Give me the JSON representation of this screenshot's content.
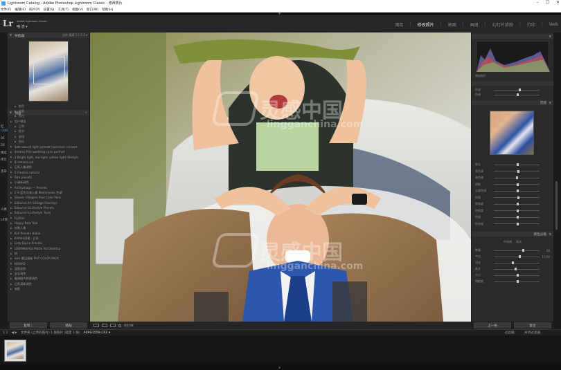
{
  "window": {
    "title": "Lightroom Catalog - Adobe Photoshop Lightroom Classic - 修改照片",
    "controls": [
      "–",
      "☐",
      "✕"
    ]
  },
  "menu": [
    "文件(F)",
    "编辑(E)",
    "照片(P)",
    "设置(S)",
    "工具(T)",
    "视图(V)",
    "窗口(W)",
    "帮助(H)"
  ],
  "identity": {
    "logo": "Lr",
    "subtitle": "Adobe Lightroom Classic",
    "user": "喵 渣 ▾"
  },
  "modules": {
    "items": [
      "图库",
      "修改照片",
      "地图",
      "画册",
      "幻灯片放映",
      "打印",
      "Web"
    ],
    "active_index": 1
  },
  "left_panel": {
    "navigator_header": "导航器",
    "navigator_right": "适合 填满 1:1 1:3 ▾",
    "presets_header": "预设",
    "presets_header_right": "+",
    "presets": [
      {
        "label": "颜色",
        "sub": true
      },
      {
        "label": "创意",
        "sub": true
      },
      {
        "label": "黑白",
        "sub": true
      },
      {
        "label": "用户预设",
        "sub": false
      },
      {
        "label": "日常",
        "sub": true
      },
      {
        "label": "细节",
        "sub": true
      },
      {
        "label": "曲线",
        "sub": true
      },
      {
        "label": "锐化",
        "sub": true
      },
      {
        "label": "Soft natural light portrait haemazin monart",
        "sub": false
      },
      {
        "label": "dreamy film wedding cyan portrait",
        "sub": false
      },
      {
        "label": "3 Bright light, low light, yellow light lifestyle",
        "sub": false
      },
      {
        "label": "B camera set",
        "sub": false
      },
      {
        "label": "日系人像调色",
        "sub": false
      },
      {
        "label": "5 Cinema natural",
        "sub": false
      },
      {
        "label": "Film presets",
        "sub": false
      },
      {
        "label": "小清新调色",
        "sub": false
      },
      {
        "label": "Archipelago — Presets",
        "sub": false
      },
      {
        "label": "C A 蓝色冷调人像 Mommasen 色调",
        "sub": false
      },
      {
        "label": "Glacier Villagine Pool Color Pack",
        "sub": false
      },
      {
        "label": "Editorial Art Vintage Overlays",
        "sub": false
      },
      {
        "label": "Editorial & Lifestyle Presets",
        "sub": false
      },
      {
        "label": "Editorial & Lifestyle Tools",
        "sub": false
      },
      {
        "label": "Fujifilm",
        "sub": false
      },
      {
        "label": "Happy New Year",
        "sub": false
      },
      {
        "label": "肖像人像",
        "sub": false
      },
      {
        "label": "KLP Presets Hobie",
        "sub": false
      },
      {
        "label": "Kinfolk风格 · 日系",
        "sub": false
      },
      {
        "label": "Lady Byrne Presets",
        "sub": false
      },
      {
        "label": "LOWMAN Kid Matte Vol Desktop",
        "sub": false
      },
      {
        "label": "Ni",
        "sub": false
      },
      {
        "label": "own 夏日清新 PHP COLOR PACK",
        "sub": false
      },
      {
        "label": "NOMAD",
        "sub": false
      },
      {
        "label": "温柔皮肤",
        "sub": false
      },
      {
        "label": "宝宝调色",
        "sub": false
      },
      {
        "label": "暖调胶片质感调色",
        "sub": false
      },
      {
        "label": "日系清新调色",
        "sub": false
      },
      {
        "label": "电影",
        "sub": false
      }
    ],
    "side_labels": [
      "红",
      "(1000)/5",
      "05",
      "20",
      "精选",
      "拷贝",
      "黑白",
      "人像",
      "LR预设"
    ],
    "buttons": [
      "复制...",
      "粘贴"
    ]
  },
  "toolbar": {
    "label": "软打样"
  },
  "right_panel": {
    "hist_label": "原始照片",
    "basic_rows": [
      {
        "label": "色温",
        "value": "",
        "pos": 0.55
      },
      {
        "label": "色调",
        "value": "",
        "pos": 0.5
      }
    ],
    "section_header_1": "范围",
    "tone_rows": [
      {
        "label": "高光",
        "value": "",
        "pos": 0.5
      },
      {
        "label": "亮色调",
        "value": "",
        "pos": 0.52
      },
      {
        "label": "暗色调",
        "value": "",
        "pos": 0.48
      },
      {
        "label": "阴影",
        "value": "",
        "pos": 0.5
      },
      {
        "label": "分离色调",
        "value": "",
        "pos": 0.5
      },
      {
        "label": "色相",
        "value": "",
        "pos": 0.52
      },
      {
        "label": "饱和度",
        "value": "",
        "pos": 0.5
      },
      {
        "label": "明亮度",
        "value": "",
        "pos": 0.5
      },
      {
        "label": "色相",
        "value": "",
        "pos": 0.5
      },
      {
        "label": "饱和度",
        "value": "",
        "pos": 0.5
      }
    ],
    "section_header_2": "颜色分级",
    "grading_labels": [
      "中间调",
      "高光"
    ],
    "grading_rows": [
      {
        "label": "数量",
        "value": "28",
        "pos": 0.62
      },
      {
        "label": "中点",
        "value": "17/46",
        "pos": 0.55
      },
      {
        "label": "羽化",
        "value": "",
        "pos": 0.4
      },
      {
        "label": "高光",
        "value": "",
        "pos": 0.45
      },
      {
        "label": "大小",
        "value": "",
        "pos": 0.5
      },
      {
        "label": "粗糙度",
        "value": "",
        "pos": 0.5
      }
    ],
    "buttons": [
      "上一张",
      "复位"
    ]
  },
  "bottom_bar": {
    "page_icons": "1 2",
    "nav": "◀ ▶",
    "path": "文件夹 (上传的照片)  1 张照片 /选定 1 张/",
    "filename": "A09G1559.CR2 ▾",
    "filter_label": "过滤器：",
    "filter_value": "关闭过滤器"
  },
  "watermark": {
    "brand_cn": "灵感中国",
    "domain": "lingganchina.com"
  },
  "colors": {
    "accent_active": "#e6e6e6",
    "panel": "#2a2a2a",
    "side_accent": "#6fa8dc"
  }
}
